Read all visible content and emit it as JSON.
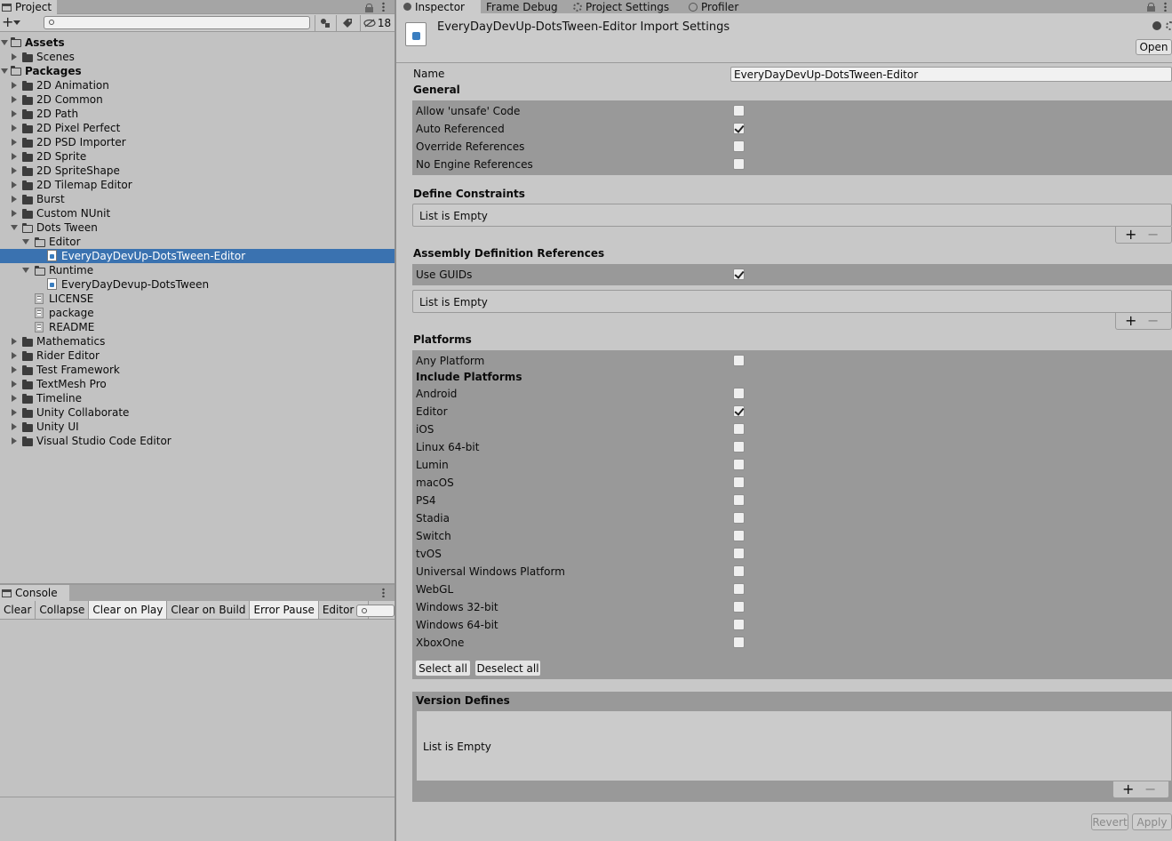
{
  "project": {
    "tab_label": "Project",
    "hidden_count": "18",
    "tree": [
      {
        "label": "Assets",
        "bold": true
      },
      {
        "label": "Scenes"
      },
      {
        "label": "Packages",
        "bold": true
      },
      {
        "label": "2D Animation"
      },
      {
        "label": "2D Common"
      },
      {
        "label": "2D Path"
      },
      {
        "label": "2D Pixel Perfect"
      },
      {
        "label": "2D PSD Importer"
      },
      {
        "label": "2D Sprite"
      },
      {
        "label": "2D SpriteShape"
      },
      {
        "label": "2D Tilemap Editor"
      },
      {
        "label": "Burst"
      },
      {
        "label": "Custom NUnit"
      },
      {
        "label": "Dots Tween"
      },
      {
        "label": "Editor"
      },
      {
        "label": "EveryDayDevUp-DotsTween-Editor",
        "selected": true
      },
      {
        "label": "Runtime"
      },
      {
        "label": "EveryDayDevup-DotsTween"
      },
      {
        "label": "LICENSE"
      },
      {
        "label": "package"
      },
      {
        "label": "README"
      },
      {
        "label": "Mathematics"
      },
      {
        "label": "Rider Editor"
      },
      {
        "label": "Test Framework"
      },
      {
        "label": "TextMesh Pro"
      },
      {
        "label": "Timeline"
      },
      {
        "label": "Unity Collaborate"
      },
      {
        "label": "Unity UI"
      },
      {
        "label": "Visual Studio Code Editor"
      }
    ]
  },
  "console": {
    "tab_label": "Console",
    "toolbar": [
      {
        "label": "Clear",
        "on": false
      },
      {
        "label": "Collapse",
        "on": false
      },
      {
        "label": "Clear on Play",
        "on": true
      },
      {
        "label": "Clear on Build",
        "on": false
      },
      {
        "label": "Error Pause",
        "on": true
      },
      {
        "label": "Editor",
        "on": false,
        "dropdown": true
      }
    ]
  },
  "inspector": {
    "tabs": [
      {
        "label": "Inspector",
        "icon": "info-icon"
      },
      {
        "label": "Frame Debug"
      },
      {
        "label": "Project Settings",
        "icon": "gear-icon"
      },
      {
        "label": "Profiler",
        "icon": "profiler-icon"
      }
    ],
    "header_title": "EveryDayDevUp-DotsTween-Editor Import Settings",
    "open_button": "Open",
    "name_label": "Name",
    "name_value": "EveryDayDevUp-DotsTween-Editor",
    "general": {
      "title": "General",
      "options": [
        {
          "label": "Allow 'unsafe' Code",
          "checked": false
        },
        {
          "label": "Auto Referenced",
          "checked": true
        },
        {
          "label": "Override References",
          "checked": false
        },
        {
          "label": "No Engine References",
          "checked": false
        }
      ]
    },
    "define_constraints": {
      "title": "Define Constraints",
      "empty": "List is Empty"
    },
    "assembly_refs": {
      "title": "Assembly Definition References",
      "use_guids_label": "Use GUIDs",
      "use_guids": true,
      "empty": "List is Empty"
    },
    "platforms": {
      "title": "Platforms",
      "any_platform": "Any Platform",
      "any_checked": false,
      "include_label": "Include Platforms",
      "list": [
        {
          "label": "Android",
          "checked": false
        },
        {
          "label": "Editor",
          "checked": true
        },
        {
          "label": "iOS",
          "checked": false
        },
        {
          "label": "Linux 64-bit",
          "checked": false
        },
        {
          "label": "Lumin",
          "checked": false
        },
        {
          "label": "macOS",
          "checked": false
        },
        {
          "label": "PS4",
          "checked": false
        },
        {
          "label": "Stadia",
          "checked": false
        },
        {
          "label": "Switch",
          "checked": false
        },
        {
          "label": "tvOS",
          "checked": false
        },
        {
          "label": "Universal Windows Platform",
          "checked": false
        },
        {
          "label": "WebGL",
          "checked": false
        },
        {
          "label": "Windows 32-bit",
          "checked": false
        },
        {
          "label": "Windows 64-bit",
          "checked": false
        },
        {
          "label": "XboxOne",
          "checked": false
        }
      ],
      "select_all": "Select all",
      "deselect_all": "Deselect all"
    },
    "version_defines": {
      "title": "Version Defines",
      "empty": "List is Empty"
    },
    "revert": "Revert",
    "apply": "Apply"
  }
}
